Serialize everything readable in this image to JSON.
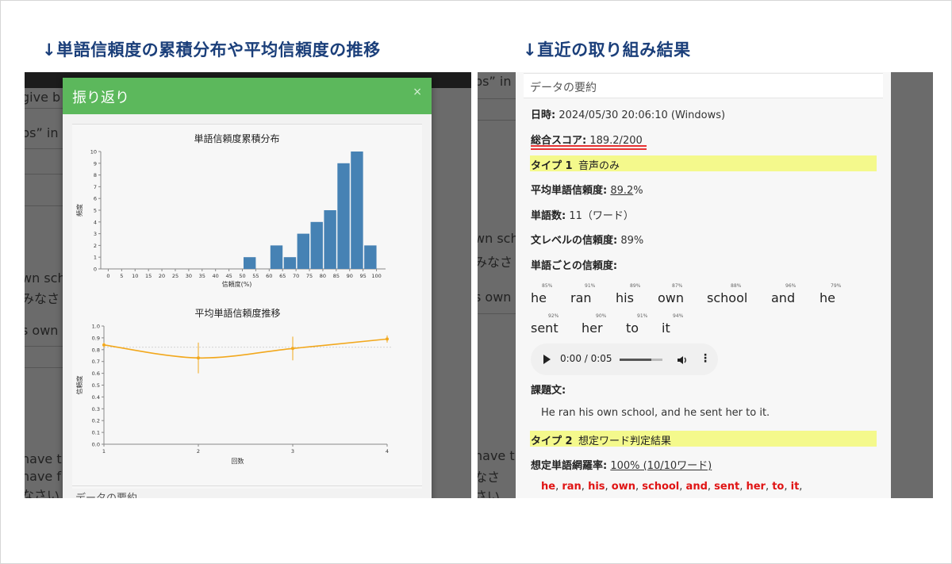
{
  "headings": {
    "left": "↓単語信頼度の累積分布や平均信頼度の推移",
    "right": "↓直近の取り組み結果"
  },
  "left_background": {
    "texts": [
      "give b",
      "ps” in l",
      "wn sch",
      "みなさ",
      "s own",
      "have t",
      "have f",
      "なさい"
    ]
  },
  "right_background": {
    "left_texts": [
      "ps” in l",
      "wn sch",
      "みなさ",
      "s own",
      "have t",
      "なさ",
      "さい"
    ]
  },
  "modal": {
    "title": "振り返り",
    "close": "×",
    "footer": "データの要約"
  },
  "chart_data": [
    {
      "type": "bar",
      "title": "単語信頼度累積分布",
      "xlabel": "信頼度(%)",
      "ylabel": "頻度",
      "categories": [
        "0",
        "5",
        "10",
        "15",
        "20",
        "25",
        "30",
        "35",
        "40",
        "45",
        "50",
        "55",
        "60",
        "65",
        "70",
        "75",
        "80",
        "85",
        "90",
        "95",
        "100"
      ],
      "values": [
        0,
        0,
        0,
        0,
        0,
        0,
        0,
        0,
        0,
        0,
        1,
        0,
        2,
        1,
        3,
        4,
        5,
        9,
        10,
        2,
        0
      ],
      "ylim": [
        0,
        10
      ],
      "yticks": [
        "0",
        "1",
        "2",
        "3",
        "4",
        "5",
        "6",
        "7",
        "8",
        "9",
        "10"
      ],
      "color": "#4682b4"
    },
    {
      "type": "line",
      "title": "平均単語信頼度推移",
      "xlabel": "回数",
      "ylabel": "信頼度",
      "x": [
        1,
        2,
        3,
        4
      ],
      "y": [
        0.84,
        0.73,
        0.81,
        0.89
      ],
      "error": [
        0.02,
        0.13,
        0.1,
        0.03
      ],
      "reference": 0.82,
      "xticks": [
        "1",
        "2",
        "3",
        "4"
      ],
      "yticks": [
        "0.0",
        "0.1",
        "0.2",
        "0.3",
        "0.4",
        "0.5",
        "0.6",
        "0.7",
        "0.8",
        "0.9",
        "1.0"
      ],
      "ylim": [
        0,
        1
      ],
      "xlim": [
        1,
        4
      ],
      "color": "#f2a81d"
    }
  ],
  "summary": {
    "header": "データの要約",
    "date_label": "日時:",
    "date_value": "2024/05/30 20:06:10 (Windows)",
    "score_label": "総合スコア:",
    "score_value": "189.2/200",
    "type1_label": "タイプ 1",
    "type1_name": "音声のみ",
    "avg_label": "平均単語信頼度:",
    "avg_value": "89.2",
    "avg_unit": "%",
    "count_label": "単語数:",
    "count_value": "11（ワード）",
    "sentence_label": "文レベルの信頼度:",
    "sentence_value": "89%",
    "perword_label": "単語ごとの信頼度:",
    "words_row1": [
      {
        "w": "he",
        "p": "85%"
      },
      {
        "w": "ran",
        "p": "91%"
      },
      {
        "w": "his",
        "p": "89%"
      },
      {
        "w": "own",
        "p": "87%"
      },
      {
        "w": "school",
        "p": "88%"
      },
      {
        "w": "and",
        "p": "96%"
      },
      {
        "w": "he",
        "p": "79%"
      }
    ],
    "words_row2": [
      {
        "w": "sent",
        "p": "92%"
      },
      {
        "w": "her",
        "p": "90%"
      },
      {
        "w": "to",
        "p": "91%"
      },
      {
        "w": "it",
        "p": "94%"
      }
    ],
    "audio_time": "0:00 / 0:05",
    "task_label": "課題文:",
    "task_text": "He ran his own school, and he sent her to it.",
    "type2_label": "タイプ 2",
    "type2_name": "想定ワード判定結果",
    "coverage_label": "想定単語網羅率:",
    "coverage_value": "100% (10/10ワード)",
    "keywords": [
      "he",
      "ran",
      "his",
      "own",
      "school",
      "and",
      "sent",
      "her",
      "to",
      "it"
    ]
  }
}
